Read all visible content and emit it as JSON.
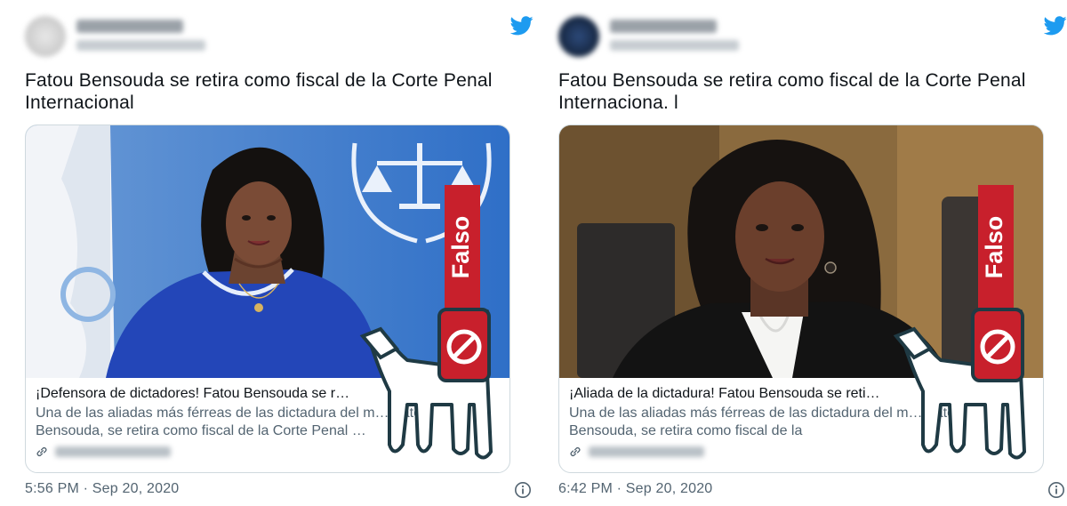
{
  "tweets": [
    {
      "text": "Fatou Bensouda se retira como fiscal de la Corte Penal Internacional",
      "card_title": "¡Defensora de dictadores! Fatou Bensouda se r…",
      "card_desc": "Una de las aliadas más férreas de las dictadura del m… Fatou Bensouda, se retira como fiscal de la Corte Penal …",
      "timestamp": "5:56 PM · Sep 20, 2020",
      "stamp_label": "Falso"
    },
    {
      "text": "Fatou Bensouda se retira como fiscal de la Corte Penal Internaciona. l",
      "card_title": "¡Aliada de la dictadura! Fatou Bensouda se reti…",
      "card_desc": "Una de las aliadas más férreas de las dictadura del m… Fatou Bensouda, se retira como fiscal de la",
      "timestamp": "6:42 PM · Sep 20, 2020",
      "stamp_label": "Falso"
    }
  ],
  "colors": {
    "twitter_blue": "#1d9bf0",
    "stamp_red": "#c8202c",
    "stamp_outline": "#1f3a44"
  },
  "icons": [
    "twitter-bird-icon",
    "link-icon",
    "info-icon",
    "prohibited-icon"
  ]
}
